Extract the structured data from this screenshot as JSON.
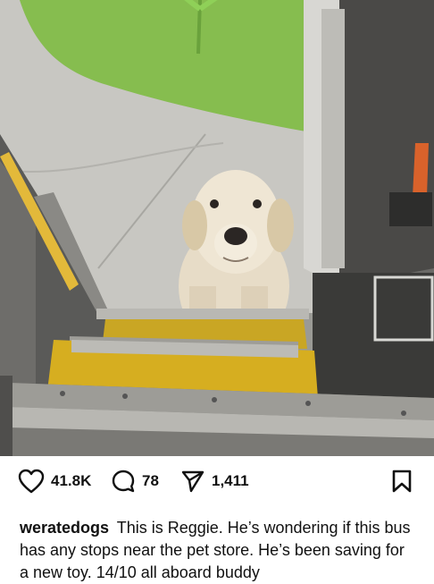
{
  "post": {
    "image_alt": "Golden retriever standing at the steps of a bus doorway",
    "likes": "41.8K",
    "comments": "78",
    "shares": "1,411",
    "username": "weratedogs",
    "caption": "This is Reggie. He’s wondering if this bus has any stops near the pet store. He’s been saving for a new toy. 14/10 all aboard buddy"
  },
  "icons": {
    "like": "heart-icon",
    "comment": "comment-icon",
    "share": "paper-plane-icon",
    "save": "bookmark-icon"
  },
  "colors": {
    "text": "#111111",
    "background": "#ffffff"
  }
}
